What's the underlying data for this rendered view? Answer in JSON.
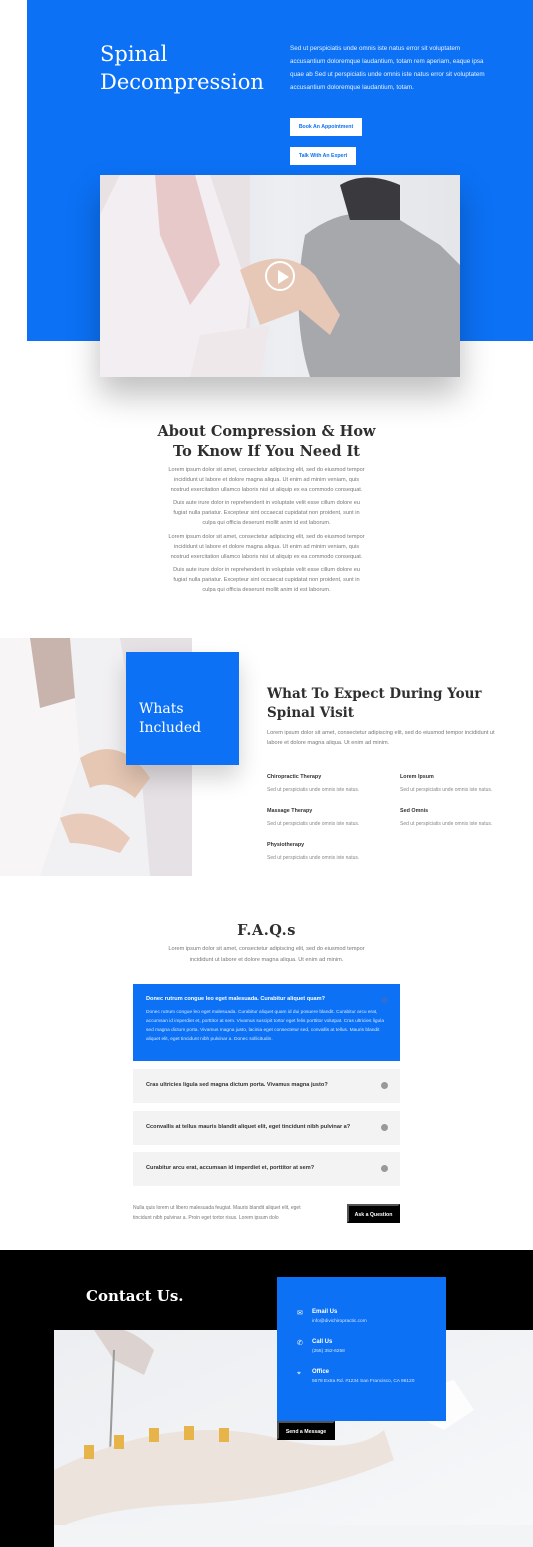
{
  "hero": {
    "title": "Spinal Decompression",
    "text": "Sed ut perspiciatis unde omnis iste natus error sit voluptatem accusantium doloremque laudantium, totam rem aperiam, eaque ipsa quae ab Sed ut perspiciatis unde omnis iste natus error sit voluptatem accusantium doloremque laudantium, totam.",
    "button_appointment": "Book An Appointment",
    "button_expert": "Talk With An Expert"
  },
  "about": {
    "title": "About Compression & How To Know If You Need It",
    "paragraphs": [
      "Lorem ipsum dolor sit amet, consectetur adipiscing elit, sed do eiusmod tempor incididunt ut labore et dolore magna aliqua. Ut enim ad minim veniam, quis nostrud exercitation ullamco laboris nisi ut aliquip ex ea commodo consequat.",
      "Duis aute irure dolor in reprehenderit in voluptate velit esse cillum dolore eu fugiat nulla pariatur. Excepteur sint occaecat cupidatat non proident, sunt in culpa qui officia deserunt mollit anim id est laborum.",
      "Lorem ipsum dolor sit amet, consectetur adipiscing elit, sed do eiusmod tempor incididunt ut labore et dolore magna aliqua. Ut enim ad minim veniam, quis nostrud exercitation ullamco laboris nisi ut aliquip ex ea commodo consequat.",
      "Duis aute irure dolor in reprehenderit in voluptate velit esse cillum dolore eu fugiat nulla pariatur. Excepteur sint occaecat cupidatat non proident, sunt in culpa qui officia deserunt mollit anim id est laborum."
    ]
  },
  "included": {
    "box_label": "Whats Included",
    "title": "What To Expect During Your Spinal Visit",
    "description": "Lorem ipsum dolor sit amet, consectetur adipiscing elit, sed do eiusmod tempor incididunt ut labore et dolore magna aliqua. Ut enim ad minim.",
    "services": [
      {
        "name": "Chiropractic Therapy",
        "desc": "Sed ut perspiciatis unde omnis iste natus."
      },
      {
        "name": "Lorem Ipsum",
        "desc": "Sed ut perspiciatis unde omnis iste natus."
      },
      {
        "name": "Massage Therapy",
        "desc": "Sed ut perspiciatis unde omnis iste natus."
      },
      {
        "name": "Sed Omnis",
        "desc": "Sed ut perspiciatis unde omnis iste natus."
      },
      {
        "name": "Physiotherapy",
        "desc": "Sed ut perspiciatis unde omnis iste natus."
      }
    ]
  },
  "faq": {
    "title": "F.A.Q.s",
    "subtitle": "Lorem ipsum dolor sit amet, consectetur adipiscing elit, sed do eiusmod tempor incididunt ut labore et dolore magna aliqua. Ut enim ad minim.",
    "open_question": "Donec rutrum congue leo eget malesuada. Curabitur aliquet quam?",
    "open_answer": "Donec rutrum congue leo eget malesuada. Curabitur aliquet quam id dui posuere blandit. Curabitur arcu erat, accumsan id imperdiet et, porttitor at sem. Vivamus suscipit tortor eget felis porttitor volutpat. Cras ultricies ligula sed magna dictum porta. Vivamus magna justo, lacinia eget consectetur sed, convallis at tellus. Mauris blandit aliquet elit, eget tincidunt nibh pulvinar a. Donec sollicitudin.",
    "questions": [
      "Cras ultricies ligula sed magna dictum porta. Vivamus magna justo?",
      "Cconvallis at tellus mauris blandit aliquet elit, eget tincidunt nibh pulvinar a?",
      "Curabitur arcu erat, accumsan id imperdiet et, porttitor at sem?"
    ],
    "note": "Nulla quis lorem ut libero malesuada feugiat. Mauris blandit aliquet elit, eget tincidunt nibh pulvinar a. Proin eget tortor risus. Lorem ipsum dolo",
    "button_question": "Ask a Question"
  },
  "contact": {
    "title": "Contact Us.",
    "items": [
      {
        "icon": "envelope-icon",
        "title": "Email Us",
        "value": "info@divichiropractic.com"
      },
      {
        "icon": "phone-icon",
        "title": "Call Us",
        "value": "(255) 352-6258"
      },
      {
        "icon": "map-pin-icon",
        "title": "Office",
        "value": "5678 Extra Rd. #1234 San Francisco, CA 96120"
      }
    ],
    "button_message": "Send a Message"
  },
  "colors": {
    "accent": "#0c71f5",
    "dark": "#000000",
    "faq_closed_bg": "#f3f3f3"
  }
}
